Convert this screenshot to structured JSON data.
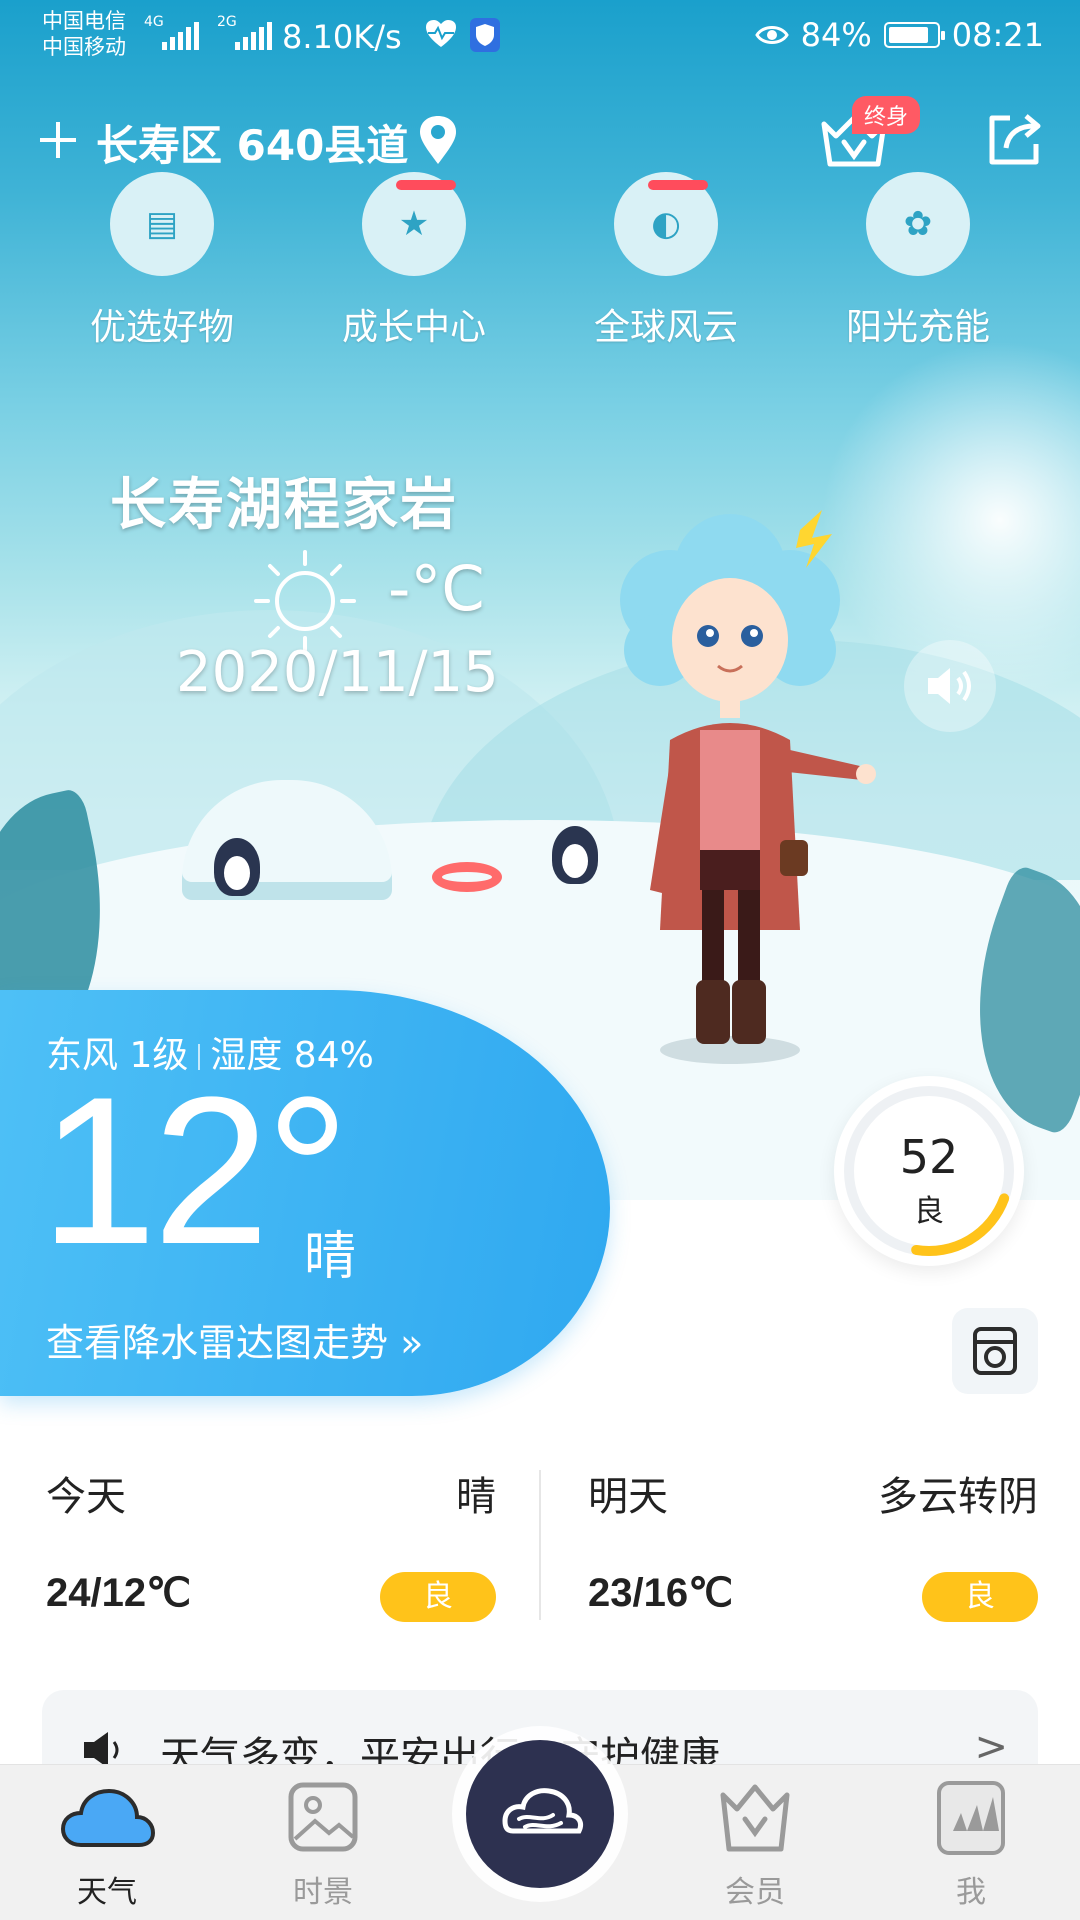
{
  "status_bar": {
    "carrier_top": "中国电信",
    "carrier_bottom": "中国移动",
    "net_type_1": "4G",
    "net_type_2": "2G",
    "net_speed": "8.10K/s",
    "battery": "84%",
    "battery_level": 0.84,
    "time": "08:21"
  },
  "header": {
    "location": "长寿区 640县道",
    "vip_badge": "终身"
  },
  "quick_menu": [
    {
      "label": "优选好物"
    },
    {
      "label": "成长中心"
    },
    {
      "label": "全球风云"
    },
    {
      "label": "阳光充能"
    }
  ],
  "place": {
    "name": "长寿湖程家岩",
    "temp": "-°C",
    "date": "2020/11/15"
  },
  "now": {
    "wind": "东风 1级",
    "humidity": "湿度 84%",
    "temp": "12°",
    "condition": "晴",
    "radar_link": "查看降水雷达图走势 »"
  },
  "aqi": {
    "value": "52",
    "level": "良",
    "progress": 0.22,
    "color": "#ffc31a"
  },
  "forecast": [
    {
      "day": "今天",
      "condition": "晴",
      "range": "24/12℃",
      "aqi": "良"
    },
    {
      "day": "明天",
      "condition": "多云转阴",
      "range": "23/16℃",
      "aqi": "良"
    }
  ],
  "notice": {
    "text": "天气多变，平安出行，守护健康",
    "arrow": ">"
  },
  "tabs": [
    {
      "label": "天气",
      "icon": "cloud-icon",
      "active": true
    },
    {
      "label": "时景",
      "icon": "image-icon",
      "active": false
    },
    {
      "label": "",
      "icon": "wind-cloud-icon",
      "active": false
    },
    {
      "label": "会员",
      "icon": "crown-icon",
      "active": false
    },
    {
      "label": "我",
      "icon": "adidas-avatar-icon",
      "active": false
    }
  ],
  "colors": {
    "accent_blue": "#2fa8f0",
    "badge_red": "#ff5a64",
    "aqi_yellow": "#ffc31a",
    "center_button": "#2d3150"
  }
}
